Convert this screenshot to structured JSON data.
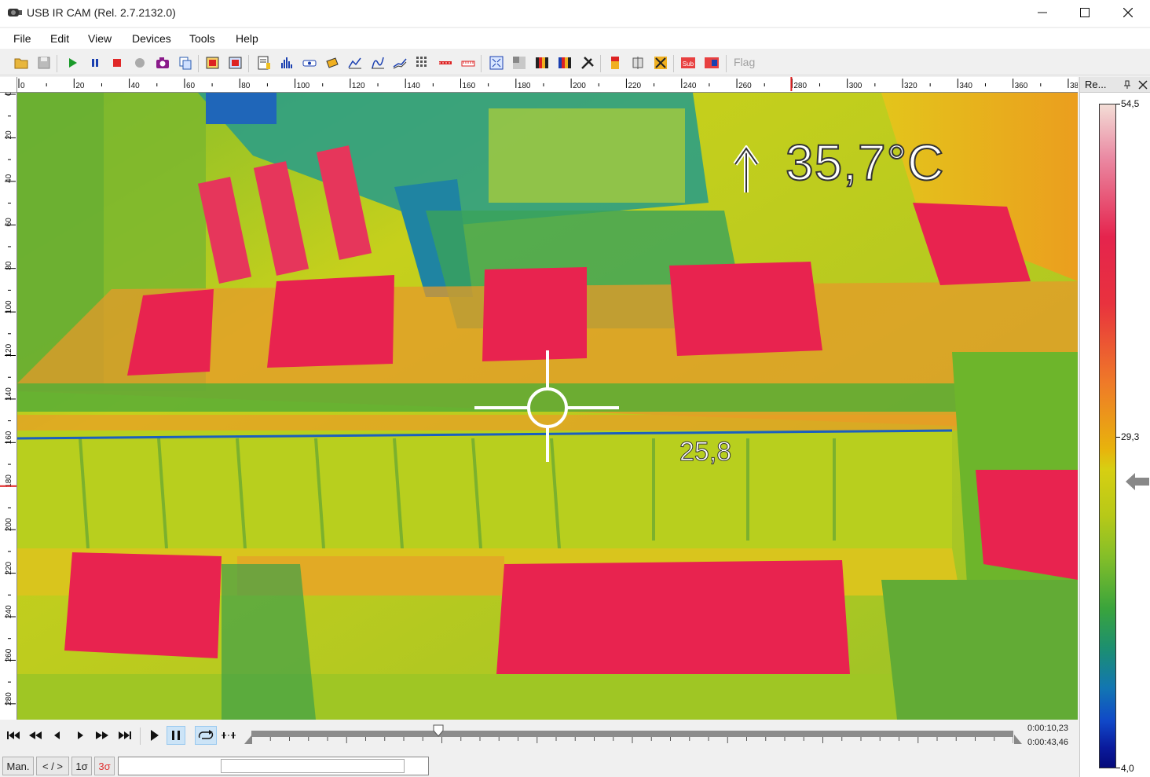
{
  "window": {
    "title": "USB IR CAM (Rel. 2.7.2132.0)"
  },
  "menu": [
    "File",
    "Edit",
    "View",
    "Devices",
    "Tools",
    "Help"
  ],
  "toolbar": {
    "flag_label": "Flag",
    "icons": [
      "open-folder-icon",
      "save-icon",
      "play-icon",
      "pause-icon",
      "stop-icon",
      "record-icon",
      "camera-icon",
      "copy-icon",
      "image-export-icon",
      "image-import-icon",
      "report-icon",
      "histogram-icon",
      "measure-icon",
      "hotspot-icon",
      "line-profile-icon",
      "curve-icon",
      "trend-icon",
      "grid-icon",
      "bar-icon",
      "ruler-icon",
      "fullscreen-icon",
      "gray-palette-icon",
      "palette-icon",
      "iron-palette-icon",
      "tools-icon",
      "color-scale-icon",
      "align-icon",
      "calibrate-icon",
      "sub-icon",
      "compare-icon"
    ]
  },
  "ruler_top": {
    "labels": [
      "0",
      "20",
      "40",
      "60",
      "80",
      "100",
      "120",
      "140",
      "160",
      "180",
      "200",
      "220",
      "240",
      "260",
      "280",
      "300",
      "320",
      "340",
      "360",
      "380"
    ],
    "max": 384,
    "marker": 280
  },
  "ruler_left": {
    "labels": [
      "0",
      "20",
      "40",
      "60",
      "80",
      "100",
      "120",
      "140",
      "160",
      "180",
      "200",
      "220",
      "240",
      "260",
      "280"
    ],
    "max": 288,
    "marker": 180
  },
  "overlay": {
    "max_temp": "35,7°C",
    "spot_value": "25,8"
  },
  "right_panel": {
    "title": "Re...",
    "scale_max": "54,5",
    "scale_mid": "29,3",
    "scale_min": "4,0",
    "pointer_value": 25.8
  },
  "playback": {
    "time_current": "0:00:10,23",
    "time_total": "0:00:43,46",
    "progress": 0.245
  },
  "status": {
    "mode": "Man.",
    "range": "< / >",
    "sigma1": "1σ",
    "sigma3": "3σ"
  },
  "colors": {
    "sigma3": "#e03030",
    "hot": "#e8234f",
    "warm": "#e9a91a",
    "mid": "#c9cf1c",
    "cool": "#6cb52c",
    "cold": "#1f8e68",
    "coldest": "#1660c0"
  }
}
